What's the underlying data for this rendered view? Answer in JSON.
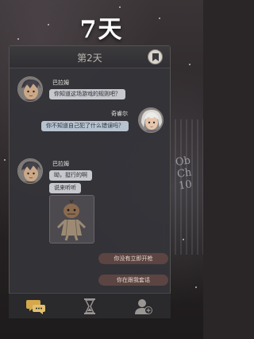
{
  "title": "7天",
  "header": {
    "day": "第2天",
    "bookmark_icon": "bookmark-icon"
  },
  "messages": [
    {
      "sender": "巴拉姆",
      "side": "left",
      "texts": [
        "你知道这场游戏的规则吧？"
      ]
    },
    {
      "sender": "奇睿尔",
      "side": "right",
      "texts": [
        "你不知道自己犯了什么错误吗？"
      ]
    },
    {
      "sender": "巴拉姆",
      "side": "left",
      "texts": [
        "呦，挺行的啊",
        "说来听听"
      ],
      "attachment": "voodoo-doll-image"
    }
  ],
  "replies": [
    "你没有立即开枪",
    "你在跟我套话"
  ],
  "nav": [
    {
      "name": "chat",
      "icon": "chat-bubbles-icon",
      "active": true
    },
    {
      "name": "time",
      "icon": "hourglass-icon",
      "active": false
    },
    {
      "name": "contacts",
      "icon": "add-contact-icon",
      "active": false
    }
  ],
  "colors": {
    "accent": "#d4a84b",
    "reply_bg": "#5b4441",
    "bubble_left": "#c7c8ce",
    "bubble_right": "#b7c3cf"
  }
}
